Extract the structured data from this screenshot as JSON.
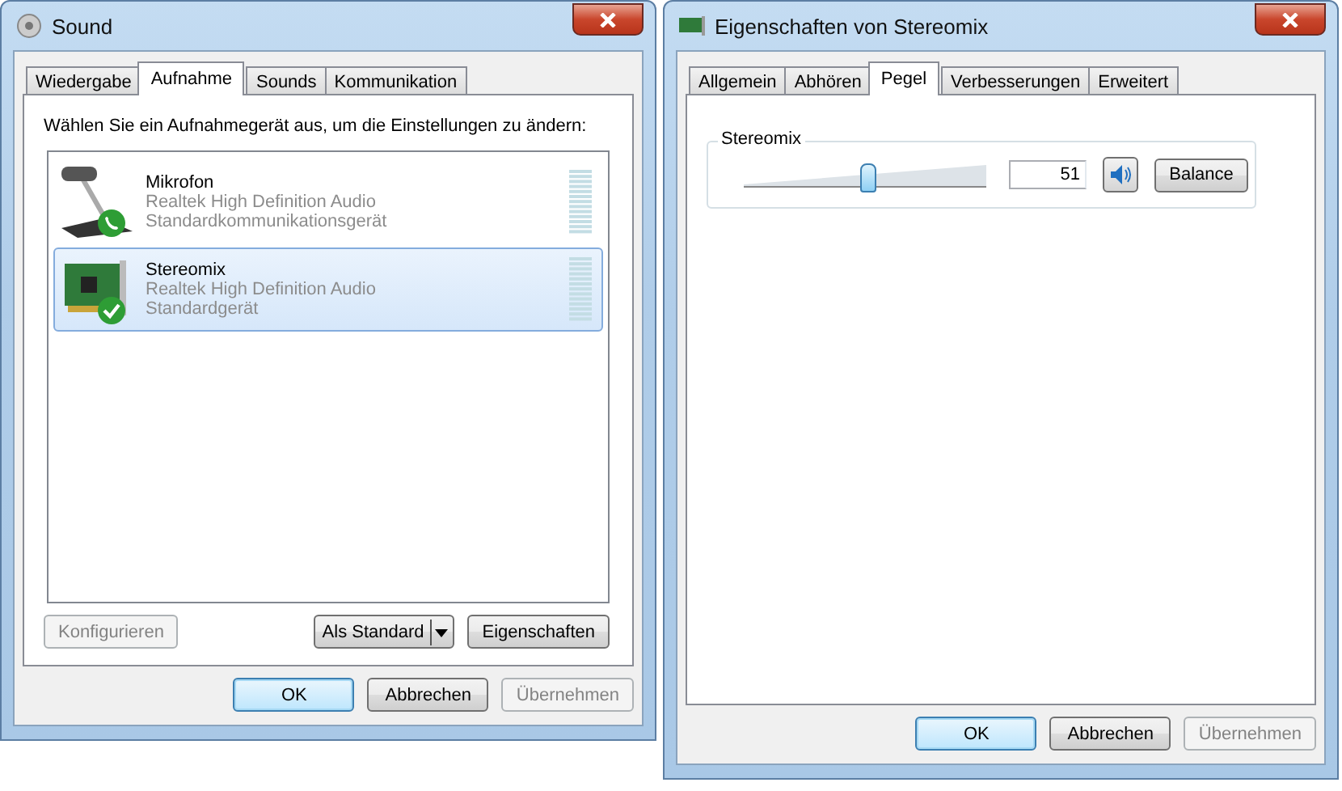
{
  "sound_window": {
    "title": "Sound",
    "tabs": [
      {
        "label": "Wiedergabe",
        "selected": false
      },
      {
        "label": "Aufnahme",
        "selected": true
      },
      {
        "label": "Sounds",
        "selected": false
      },
      {
        "label": "Kommunikation",
        "selected": false
      }
    ],
    "instruction": "Wählen Sie ein Aufnahmegerät aus, um die Einstellungen zu ändern:",
    "devices": [
      {
        "name": "Mikrofon",
        "driver": "Realtek High Definition Audio",
        "status": "Standardkommunikationsgerät",
        "kind": "microphone",
        "default_communication": true,
        "default_device": false,
        "selected": false
      },
      {
        "name": "Stereomix",
        "driver": "Realtek High Definition Audio",
        "status": "Standardgerät",
        "kind": "sound-card",
        "default_communication": false,
        "default_device": true,
        "selected": true
      }
    ],
    "actions": [
      {
        "label": "Konfigurieren",
        "kind": "plain",
        "disabled": true
      },
      {
        "label": "Als Standard",
        "kind": "split",
        "disabled": false
      },
      {
        "label": "Eigenschaften",
        "kind": "plain",
        "disabled": false
      }
    ],
    "dialog_buttons": [
      {
        "label": "OK",
        "kind": "default",
        "disabled": false
      },
      {
        "label": "Abbrechen",
        "kind": "plain",
        "disabled": false
      },
      {
        "label": "Übernehmen",
        "kind": "plain",
        "disabled": true
      }
    ]
  },
  "properties_window": {
    "title": "Eigenschaften von Stereomix",
    "tabs": [
      {
        "label": "Allgemein",
        "selected": false
      },
      {
        "label": "Abhören",
        "selected": false
      },
      {
        "label": "Pegel",
        "selected": true
      },
      {
        "label": "Verbesserungen",
        "selected": false
      },
      {
        "label": "Erweitert",
        "selected": false
      }
    ],
    "group_label": "Stereomix",
    "slider": {
      "level": 0.51
    },
    "value": "51",
    "muted": false,
    "balance_button": "Balance",
    "dialog_buttons": [
      {
        "label": "OK",
        "kind": "default",
        "disabled": false
      },
      {
        "label": "Abbrechen",
        "kind": "plain",
        "disabled": false
      },
      {
        "label": "Übernehmen",
        "kind": "plain",
        "disabled": true
      }
    ]
  }
}
